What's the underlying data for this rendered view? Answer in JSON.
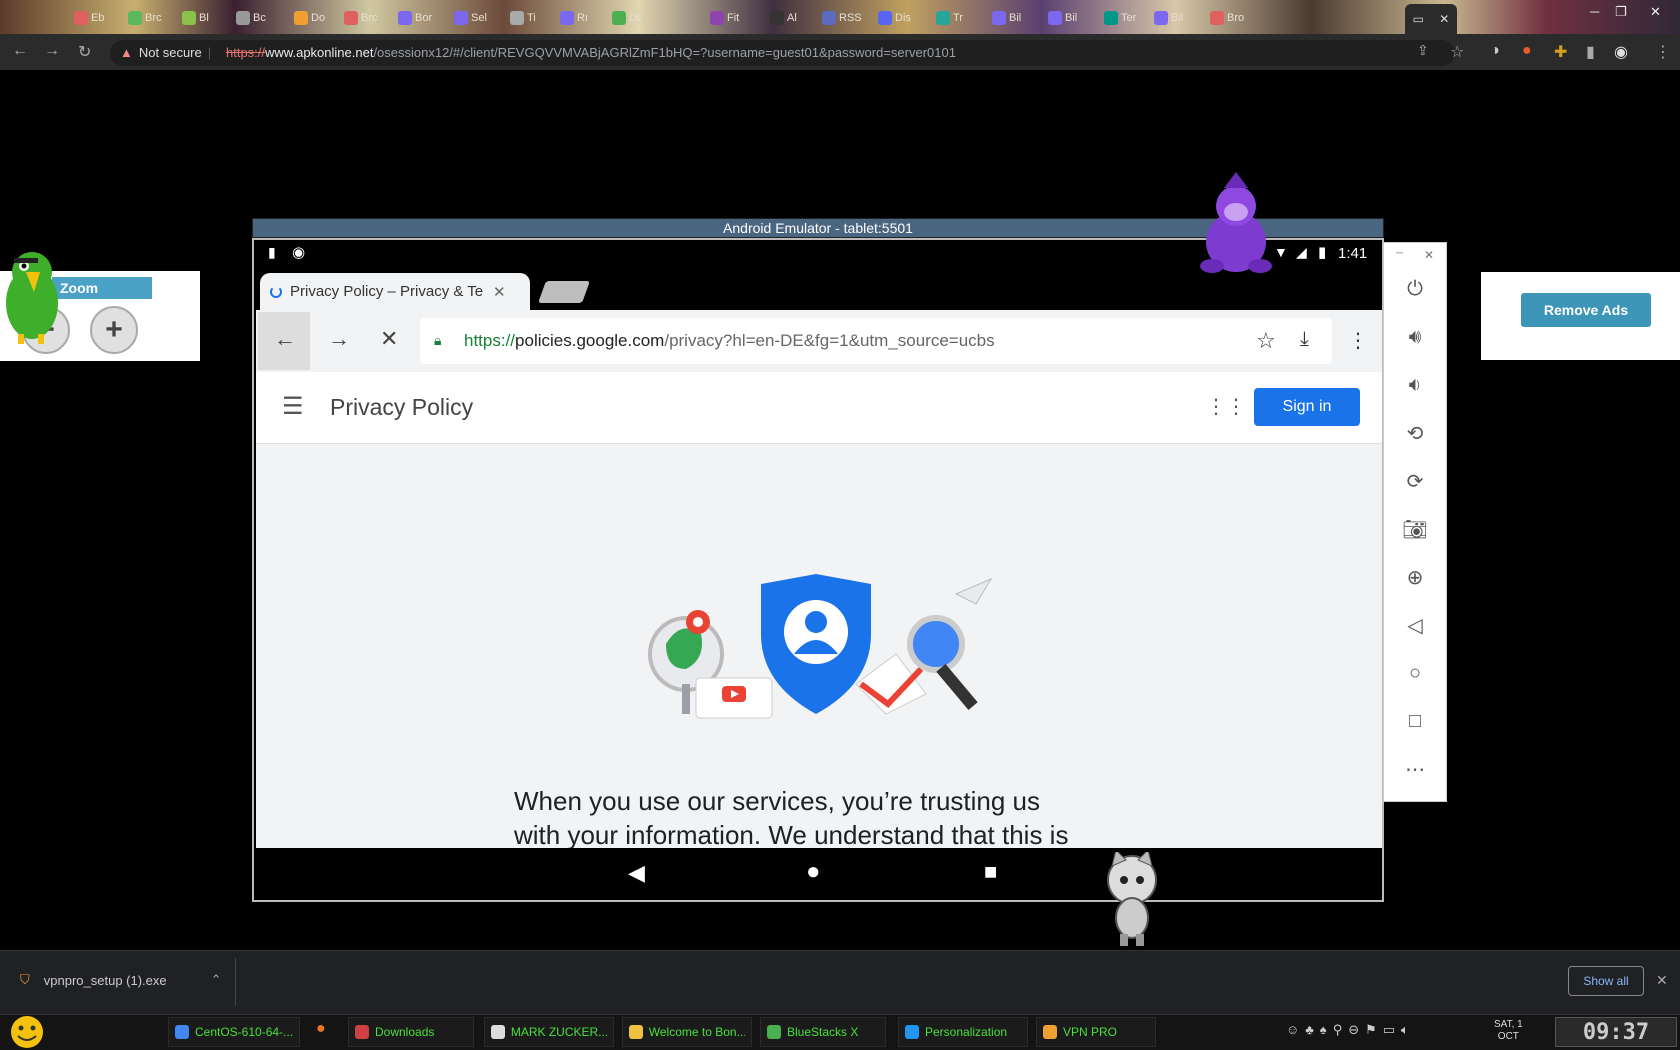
{
  "browser": {
    "tabs": [
      {
        "label": "Eb",
        "color": "#e06060"
      },
      {
        "label": "Brc",
        "color": "#5cb85c"
      },
      {
        "label": "Bl",
        "color": "#8bc34a"
      },
      {
        "label": "Bc",
        "color": "#999999"
      },
      {
        "label": "Do",
        "color": "#f0a030"
      },
      {
        "label": "Brc",
        "color": "#e06060"
      },
      {
        "label": "Bor",
        "color": "#7b68ee"
      },
      {
        "label": "Sel",
        "color": "#7b68ee"
      },
      {
        "label": "Ti",
        "color": "#aaaaaa"
      },
      {
        "label": "Rı",
        "color": "#7b68ee"
      },
      {
        "label": "Dc",
        "color": "#4caf50"
      },
      {
        "label": "Fit",
        "color": "#8e44ad"
      },
      {
        "label": "Al",
        "color": "#333333"
      },
      {
        "label": "RSS",
        "color": "#5c6bc0"
      },
      {
        "label": "Dis",
        "color": "#5865f2"
      },
      {
        "label": "Tr",
        "color": "#26a69a"
      },
      {
        "label": "Bil",
        "color": "#7b68ee"
      },
      {
        "label": "Bil",
        "color": "#7b68ee"
      },
      {
        "label": "Ter",
        "color": "#009688"
      },
      {
        "label": "Bil",
        "color": "#7b68ee"
      },
      {
        "label": "Bro",
        "color": "#e06060"
      }
    ],
    "active_tab_icon": "window-icon",
    "not_secure_label": "Not secure",
    "url_scheme": "https://",
    "url_host": "www.apkonline.net",
    "url_path": "/osessionx12/#/client/REVGQVVMVABjAGRlZmF1bHQ=?username=guest01&password=server0101"
  },
  "emulator": {
    "title": "Android Emulator - tablet:5501",
    "status_time": "1:41",
    "chrome_tab_title": "Privacy Policy – Privacy & Te",
    "url_scheme": "https://",
    "url_host": "policies.google.com",
    "url_path": "/privacy?hl=en-DE&fg=1&utm_source=ucbs",
    "page_title": "Privacy Policy",
    "signin_label": "Sign in",
    "body_text_line1": "When you use our services, you’re trusting us",
    "body_text_line2": "with your information. We understand that this is"
  },
  "side_panel": {
    "buttons": [
      "power-icon",
      "volume-up-icon",
      "volume-down-icon",
      "rotate-left-icon",
      "rotate-right-icon",
      "camera-icon",
      "zoom-in-icon",
      "back-icon",
      "home-icon",
      "overview-icon",
      "more-icon"
    ]
  },
  "zoom": {
    "label": "Zoom",
    "minus": "−",
    "plus": "+"
  },
  "ads": {
    "remove_label": "Remove Ads"
  },
  "downloads": {
    "file": "vpnpro_setup (1).exe",
    "show_all": "Show all"
  },
  "taskbar": {
    "items": [
      {
        "label": "CentOS-610-64-...",
        "color": "#4285f4"
      },
      {
        "label": "Downloads",
        "color": "#d04040"
      },
      {
        "label": "MARK ZUCKER...",
        "color": "#dddddd"
      },
      {
        "label": "Welcome to Bon...",
        "color": "#f0c040"
      },
      {
        "label": "BlueStacks X",
        "color": "#4caf50"
      },
      {
        "label": "Personalization",
        "color": "#2196f3"
      },
      {
        "label": "VPN PRO",
        "color": "#f0a030"
      }
    ],
    "date_day": "SAT, 1",
    "date_month": "OCT",
    "clock": "09:37"
  }
}
